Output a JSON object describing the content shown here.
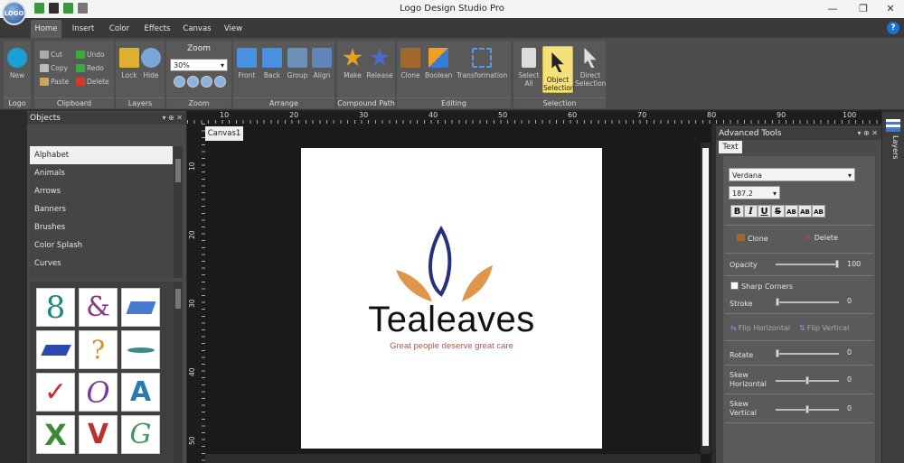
{
  "app": {
    "title": "Logo Design Studio Pro",
    "logo_text": "LOGO"
  },
  "window_controls": {
    "minimize": "—",
    "restore": "❐",
    "close": "✕"
  },
  "tabs": [
    {
      "label": "Home",
      "active": true
    },
    {
      "label": "Insert"
    },
    {
      "label": "Color"
    },
    {
      "label": "Effects"
    },
    {
      "label": "Canvas"
    },
    {
      "label": "View"
    }
  ],
  "help_label": "?",
  "ribbon": {
    "logo": {
      "label": "Logo",
      "new": "New"
    },
    "clipboard": {
      "label": "Clipboard",
      "cut": "Cut",
      "copy": "Copy",
      "paste": "Paste",
      "undo": "Undo",
      "redo": "Redo",
      "delete": "Delete"
    },
    "layers": {
      "label": "Layers",
      "lock": "Lock",
      "hide": "Hide"
    },
    "zoom": {
      "label": "Zoom",
      "title": "Zoom",
      "value": "30%"
    },
    "arrange": {
      "label": "Arrange",
      "front": "Front",
      "back": "Back",
      "group": "Group",
      "align": "Align"
    },
    "compound": {
      "label": "Compound Path",
      "make": "Make",
      "release": "Release"
    },
    "editing": {
      "label": "Editing",
      "clone": "Clone",
      "boolean": "Boolean",
      "transformation": "Transformation"
    },
    "selection": {
      "label": "Selection",
      "select_all_1": "Select",
      "select_all_2": "All",
      "object_1": "Object",
      "object_2": "Selection",
      "direct_1": "Direct",
      "direct_2": "Selection"
    }
  },
  "ruler": {
    "top": [
      "10",
      "20",
      "30",
      "40",
      "50",
      "60",
      "70",
      "80",
      "90",
      "100"
    ],
    "left": [
      "10",
      "20",
      "30",
      "40",
      "50"
    ]
  },
  "objects_panel": {
    "title": "Objects",
    "pin": "▾ ⊕ ✕",
    "categories": [
      "Alphabet",
      "Animals",
      "Arrows",
      "Banners",
      "Brushes",
      "Color Splash",
      "Curves"
    ],
    "selected": "Alphabet"
  },
  "canvas": {
    "tab": "Canvas1",
    "logo_word": "Tealeaves",
    "tagline": "Great people deserve great care"
  },
  "advanced": {
    "title": "Advanced Tools",
    "pin": "▾ ⊕ ✕",
    "text_tab": "Text",
    "font": "Verdana",
    "size": "187.2",
    "formats": [
      "B",
      "I",
      "U",
      "S",
      "AB",
      "AB",
      "AB"
    ],
    "clone": "Clone",
    "delete": "Delete",
    "opacity_label": "Opacity",
    "opacity_value": "100",
    "opacity_level": 1.0,
    "sharp_corners": "Sharp Corners",
    "stroke_label": "Stroke",
    "stroke_value": "0",
    "flip_h": "Flip Horizontal",
    "flip_v": "Flip Vertical",
    "rotate_label": "Rotate",
    "rotate_value": "0",
    "skew_h_1": "Skew",
    "skew_h_2": "Horizontal",
    "skew_h_value": "0",
    "skew_v_1": "Skew",
    "skew_v_2": "Vertical",
    "skew_v_value": "0"
  },
  "layers_tab": "Layers",
  "colors": {
    "accent_blue": "#1d6fd6",
    "logo_navy": "#27307a",
    "logo_orange": "#e0954a",
    "tagline_red": "#c0533a"
  }
}
